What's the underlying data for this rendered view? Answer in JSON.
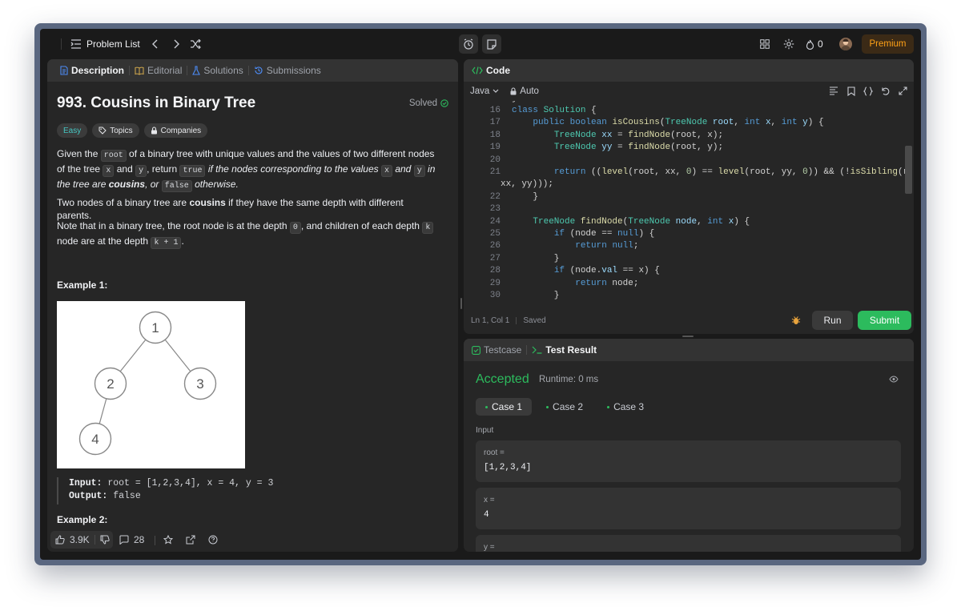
{
  "topbar": {
    "problem_list": "Problem List",
    "streak_count": "0",
    "premium": "Premium"
  },
  "left_tabs": {
    "description": "Description",
    "editorial": "Editorial",
    "solutions": "Solutions",
    "submissions": "Submissions"
  },
  "problem": {
    "title": "993. Cousins in Binary Tree",
    "solved": "Solved",
    "difficulty": "Easy",
    "topics": "Topics",
    "companies": "Companies",
    "p1": {
      "t1": "Given the ",
      "c_root": "root",
      "t2": " of a binary tree with unique values and the values of two different nodes of the tree ",
      "c_x": "x",
      "t3": " and ",
      "c_y": "y",
      "t4": ", return ",
      "c_true": "true",
      "t5": " if the nodes corresponding to the values ",
      "c_x2": "x",
      "t6": " and ",
      "c_y2": "y",
      "t7": " in the tree are ",
      "b_cousins": "cousins",
      "t8": ", or ",
      "c_false": "false",
      "t9": " otherwise."
    },
    "p2": {
      "t1": "Two nodes of a binary tree are ",
      "b_cousins": "cousins",
      "t2": " if they have the same depth with different parents."
    },
    "p3": {
      "t1": "Note that in a binary tree, the root node is at the depth ",
      "c_0": "0",
      "t2": ", and children of each depth ",
      "c_k": "k",
      "t3": " node are at the depth ",
      "c_k1": "k + 1",
      "t4": "."
    },
    "example1_title": "Example 1:",
    "tree_nodes": [
      "1",
      "2",
      "3",
      "4"
    ],
    "example1_input_label": "Input:",
    "example1_input": " root = [1,2,3,4], x = 4, y = 3",
    "example1_output_label": "Output:",
    "example1_output": " false",
    "example2_title": "Example 2:"
  },
  "left_footer": {
    "likes": "3.9K",
    "comments": "28"
  },
  "code_panel": {
    "tab": "Code",
    "language": "Java",
    "auto": "Auto",
    "status_pos": "Ln 1, Col 1",
    "status_saved": "Saved",
    "run": "Run",
    "submit": "Submit"
  },
  "result_panel": {
    "testcase_tab": "Testcase",
    "result_tab": "Test Result",
    "status": "Accepted",
    "runtime": "Runtime: 0 ms",
    "cases": [
      "Case 1",
      "Case 2",
      "Case 3"
    ],
    "input_label": "Input",
    "fields": [
      {
        "label": "root =",
        "value": "[1,2,3,4]"
      },
      {
        "label": "x =",
        "value": "4"
      },
      {
        "label": "y =",
        "value": ""
      }
    ]
  },
  "colors": {
    "accepted": "#2cbb5d",
    "submit": "#2cbb5d",
    "easy": "#46c6c2",
    "premium": "#ffa116"
  }
}
